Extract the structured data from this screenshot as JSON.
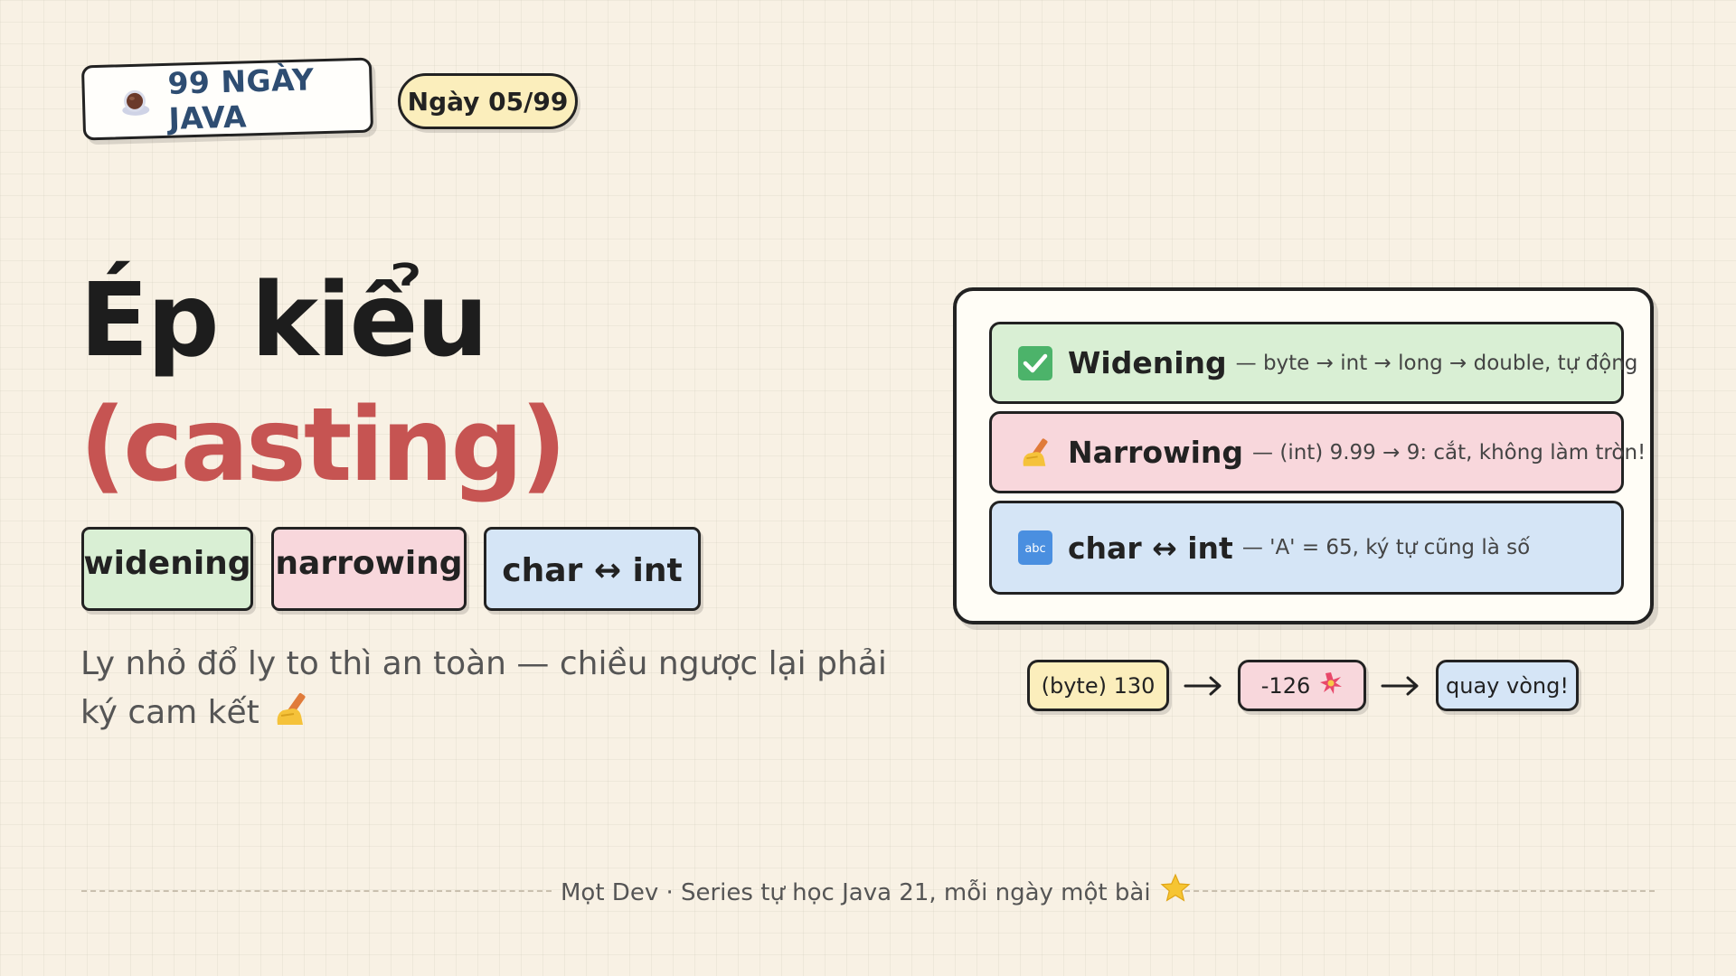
{
  "header": {
    "series_label": "99 NGÀY JAVA",
    "day_label": "Ngày 05/99"
  },
  "title": {
    "main": "Ép kiểu",
    "sub": "(casting)"
  },
  "tags": [
    {
      "label": "widening",
      "color": "#d9efd4"
    },
    {
      "label": "narrowing",
      "color": "#f8d7dc"
    },
    {
      "label": "char ↔ int",
      "color": "#d5e5f6"
    }
  ],
  "lead": {
    "text": "Ly nhỏ đổ ly to thì an toàn — chiều ngược lại phải ký cam kết",
    "icon": "writing-hand-icon"
  },
  "panel": {
    "rows": [
      {
        "icon": "check-icon",
        "title": "Widening",
        "desc": "— byte → int → long → double, tự động",
        "color": "#d9efd4"
      },
      {
        "icon": "writing-hand-icon",
        "title": "Narrowing",
        "desc": "— (int) 9.99 → 9: cắt, không làm tròn!",
        "color": "#f8d7dc"
      },
      {
        "icon": "abc-icon",
        "title": "char ↔ int",
        "desc": "— 'A' = 65, ký tự cũng là số",
        "color": "#d5e5f6"
      }
    ]
  },
  "example": {
    "input": "(byte) 130",
    "result": "-126",
    "note": "quay vòng!"
  },
  "footer": {
    "text": "Mọt Dev · Series tự học Java 21, mỗi ngày một bài"
  },
  "colors": {
    "background": "#f8f1e4",
    "accent_red": "#c65452",
    "series_blue": "#2e4d72",
    "yellow": "#fbeebc",
    "green": "#d9efd4",
    "pink": "#f8d7dc",
    "blue": "#d5e5f6"
  }
}
